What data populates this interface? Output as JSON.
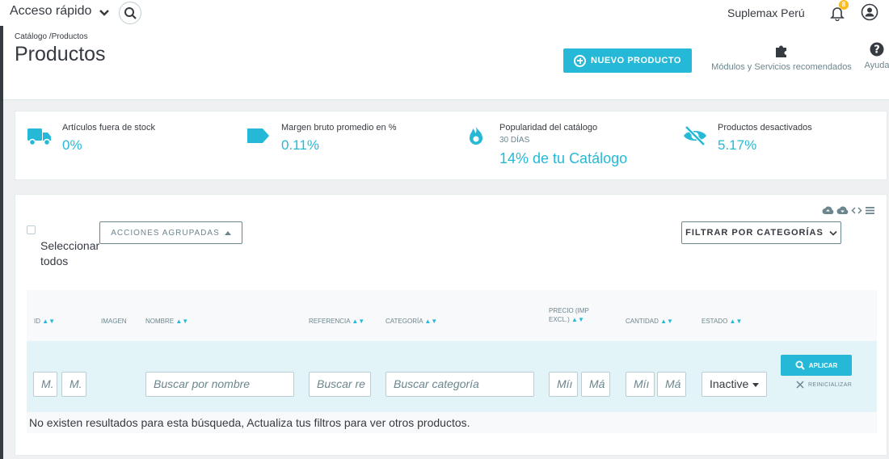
{
  "topbar": {
    "quick_access": "Acceso rápido",
    "shop_name": "Suplemax Perú",
    "notifications_count": "8"
  },
  "header": {
    "breadcrumb": "Catálogo /Productos",
    "title": "Productos",
    "new_product_label": "NUEVO PRODUCTO",
    "modules_label": "Módulos y Servicios recomendados",
    "help_label": "Ayuda"
  },
  "kpis": [
    {
      "title": "Artículos fuera de stock",
      "value": "0%",
      "icon": "truck-icon"
    },
    {
      "title": "Margen bruto promedio en %",
      "value": "0.11%",
      "icon": "tag-icon"
    },
    {
      "title": "Popularidad del catálogo",
      "subtitle": "30 DÍAS",
      "value": "14% de tu Catálogo",
      "icon": "fire-icon"
    },
    {
      "title": "Productos desactivados",
      "value": "5.17%",
      "icon": "eye-off-icon"
    }
  ],
  "panel": {
    "select_all_label": "Seleccionar todos",
    "bulk_actions_label": "ACCIONES AGRUPADAS",
    "filter_categories_label": "FILTRAR POR CATEGORÍAS",
    "columns": {
      "id": "ID",
      "image": "IMAGEN",
      "name": "NOMBRE",
      "reference": "REFERENCIA",
      "category": "CATEGORÍA",
      "price_line1": "PRECIO (IMP",
      "price_line2": "EXCL.)",
      "quantity": "CANTIDAD",
      "status": "ESTADO",
      "sort_arrows": "▲▼"
    },
    "filters": {
      "id_min": "M.",
      "id_max": "M.",
      "name_placeholder": "Buscar por nombre",
      "reference_placeholder": "Buscar re",
      "category_placeholder": "Buscar categoría",
      "price_min": "Míı",
      "price_max": "Má",
      "qty_min": "Míı",
      "qty_max": "Má",
      "status_value": "Inactive",
      "apply_label": "APLICAR",
      "reset_label": "REINICIALIZAR"
    },
    "no_results": "No existen resultados para esta búsqueda, Actualiza tus filtros para ver otros productos."
  },
  "colors": {
    "accent": "#25b9d7",
    "text": "#363a41",
    "muted": "#6c868e",
    "badge": "#fbbb22"
  }
}
